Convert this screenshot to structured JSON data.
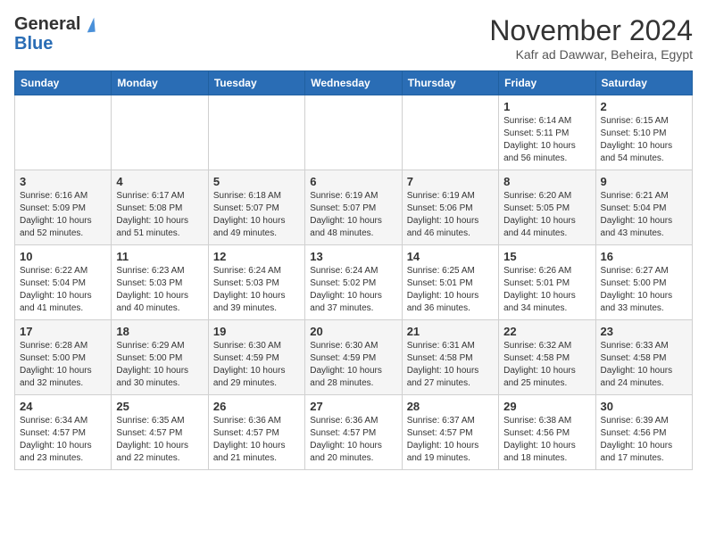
{
  "header": {
    "logo_line1": "General",
    "logo_line2": "Blue",
    "title": "November 2024",
    "subtitle": "Kafr ad Dawwar, Beheira, Egypt"
  },
  "days_of_week": [
    "Sunday",
    "Monday",
    "Tuesday",
    "Wednesday",
    "Thursday",
    "Friday",
    "Saturday"
  ],
  "weeks": [
    [
      {
        "day": "",
        "info": ""
      },
      {
        "day": "",
        "info": ""
      },
      {
        "day": "",
        "info": ""
      },
      {
        "day": "",
        "info": ""
      },
      {
        "day": "",
        "info": ""
      },
      {
        "day": "1",
        "info": "Sunrise: 6:14 AM\nSunset: 5:11 PM\nDaylight: 10 hours and 56 minutes."
      },
      {
        "day": "2",
        "info": "Sunrise: 6:15 AM\nSunset: 5:10 PM\nDaylight: 10 hours and 54 minutes."
      }
    ],
    [
      {
        "day": "3",
        "info": "Sunrise: 6:16 AM\nSunset: 5:09 PM\nDaylight: 10 hours and 52 minutes."
      },
      {
        "day": "4",
        "info": "Sunrise: 6:17 AM\nSunset: 5:08 PM\nDaylight: 10 hours and 51 minutes."
      },
      {
        "day": "5",
        "info": "Sunrise: 6:18 AM\nSunset: 5:07 PM\nDaylight: 10 hours and 49 minutes."
      },
      {
        "day": "6",
        "info": "Sunrise: 6:19 AM\nSunset: 5:07 PM\nDaylight: 10 hours and 48 minutes."
      },
      {
        "day": "7",
        "info": "Sunrise: 6:19 AM\nSunset: 5:06 PM\nDaylight: 10 hours and 46 minutes."
      },
      {
        "day": "8",
        "info": "Sunrise: 6:20 AM\nSunset: 5:05 PM\nDaylight: 10 hours and 44 minutes."
      },
      {
        "day": "9",
        "info": "Sunrise: 6:21 AM\nSunset: 5:04 PM\nDaylight: 10 hours and 43 minutes."
      }
    ],
    [
      {
        "day": "10",
        "info": "Sunrise: 6:22 AM\nSunset: 5:04 PM\nDaylight: 10 hours and 41 minutes."
      },
      {
        "day": "11",
        "info": "Sunrise: 6:23 AM\nSunset: 5:03 PM\nDaylight: 10 hours and 40 minutes."
      },
      {
        "day": "12",
        "info": "Sunrise: 6:24 AM\nSunset: 5:03 PM\nDaylight: 10 hours and 39 minutes."
      },
      {
        "day": "13",
        "info": "Sunrise: 6:24 AM\nSunset: 5:02 PM\nDaylight: 10 hours and 37 minutes."
      },
      {
        "day": "14",
        "info": "Sunrise: 6:25 AM\nSunset: 5:01 PM\nDaylight: 10 hours and 36 minutes."
      },
      {
        "day": "15",
        "info": "Sunrise: 6:26 AM\nSunset: 5:01 PM\nDaylight: 10 hours and 34 minutes."
      },
      {
        "day": "16",
        "info": "Sunrise: 6:27 AM\nSunset: 5:00 PM\nDaylight: 10 hours and 33 minutes."
      }
    ],
    [
      {
        "day": "17",
        "info": "Sunrise: 6:28 AM\nSunset: 5:00 PM\nDaylight: 10 hours and 32 minutes."
      },
      {
        "day": "18",
        "info": "Sunrise: 6:29 AM\nSunset: 5:00 PM\nDaylight: 10 hours and 30 minutes."
      },
      {
        "day": "19",
        "info": "Sunrise: 6:30 AM\nSunset: 4:59 PM\nDaylight: 10 hours and 29 minutes."
      },
      {
        "day": "20",
        "info": "Sunrise: 6:30 AM\nSunset: 4:59 PM\nDaylight: 10 hours and 28 minutes."
      },
      {
        "day": "21",
        "info": "Sunrise: 6:31 AM\nSunset: 4:58 PM\nDaylight: 10 hours and 27 minutes."
      },
      {
        "day": "22",
        "info": "Sunrise: 6:32 AM\nSunset: 4:58 PM\nDaylight: 10 hours and 25 minutes."
      },
      {
        "day": "23",
        "info": "Sunrise: 6:33 AM\nSunset: 4:58 PM\nDaylight: 10 hours and 24 minutes."
      }
    ],
    [
      {
        "day": "24",
        "info": "Sunrise: 6:34 AM\nSunset: 4:57 PM\nDaylight: 10 hours and 23 minutes."
      },
      {
        "day": "25",
        "info": "Sunrise: 6:35 AM\nSunset: 4:57 PM\nDaylight: 10 hours and 22 minutes."
      },
      {
        "day": "26",
        "info": "Sunrise: 6:36 AM\nSunset: 4:57 PM\nDaylight: 10 hours and 21 minutes."
      },
      {
        "day": "27",
        "info": "Sunrise: 6:36 AM\nSunset: 4:57 PM\nDaylight: 10 hours and 20 minutes."
      },
      {
        "day": "28",
        "info": "Sunrise: 6:37 AM\nSunset: 4:57 PM\nDaylight: 10 hours and 19 minutes."
      },
      {
        "day": "29",
        "info": "Sunrise: 6:38 AM\nSunset: 4:56 PM\nDaylight: 10 hours and 18 minutes."
      },
      {
        "day": "30",
        "info": "Sunrise: 6:39 AM\nSunset: 4:56 PM\nDaylight: 10 hours and 17 minutes."
      }
    ]
  ]
}
